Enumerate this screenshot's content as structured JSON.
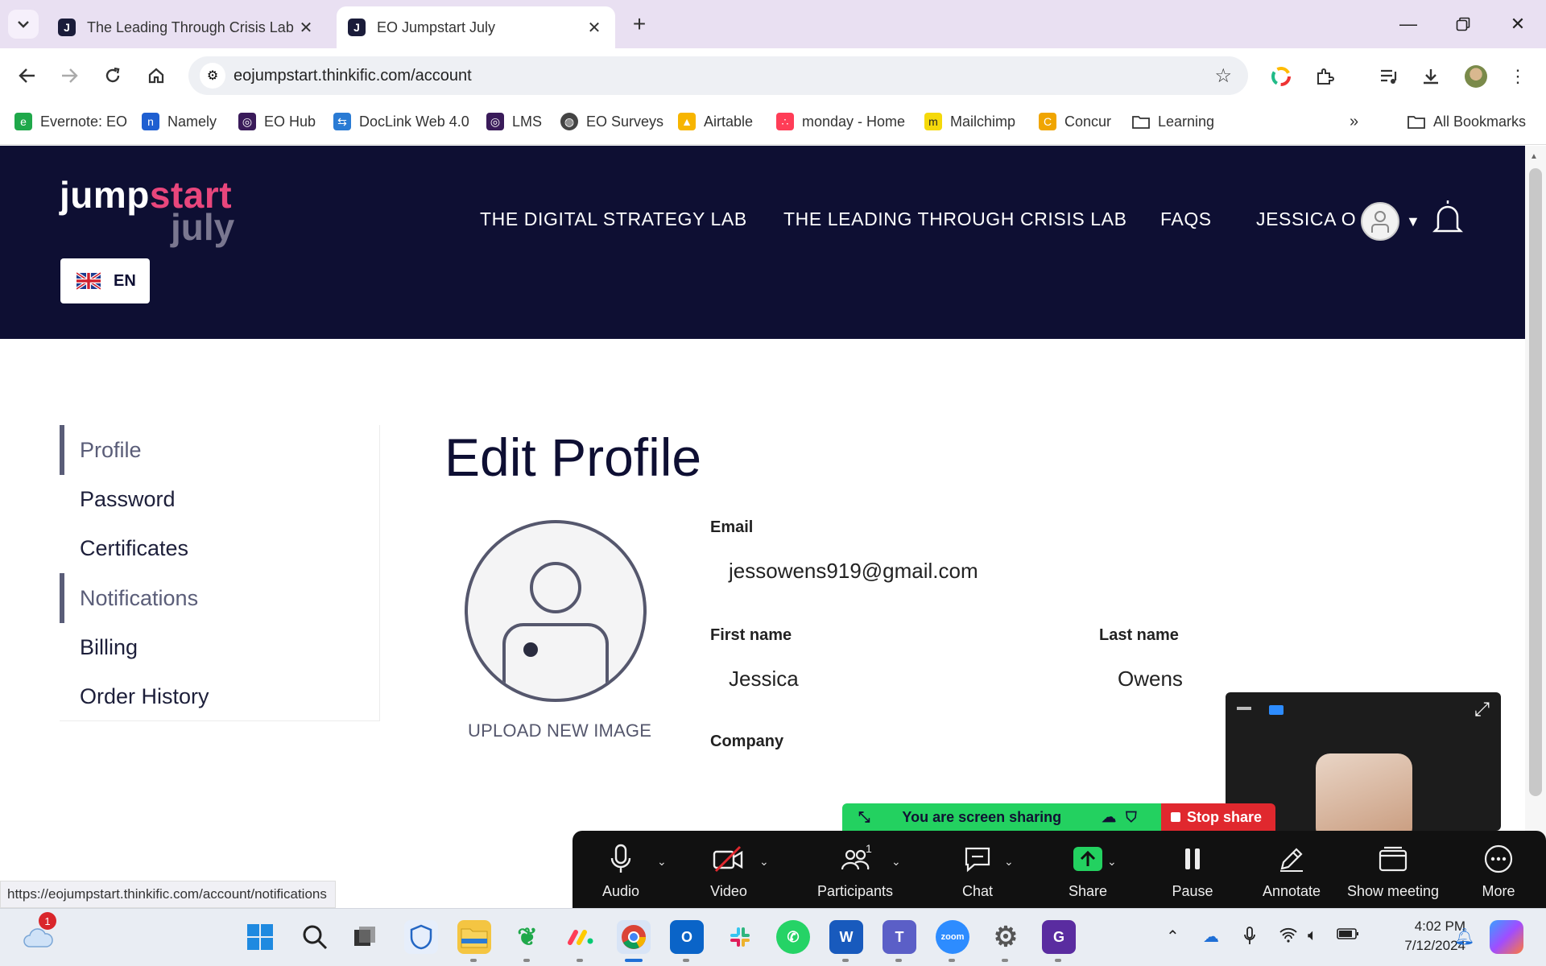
{
  "browser": {
    "tabs": [
      {
        "title": "The Leading Through Crisis Lab",
        "favicon": "J"
      },
      {
        "title": "EO Jumpstart July",
        "favicon": "J"
      }
    ],
    "url": "eojumpstart.thinkific.com/account",
    "bookmarks": [
      {
        "label": "Evernote: EO",
        "icon": "evernote-icon",
        "color": "#1fa84a"
      },
      {
        "label": "Namely",
        "icon": "namely-icon",
        "color": "#1f5fd1"
      },
      {
        "label": "EO Hub",
        "icon": "eo-hub-icon",
        "color": "#3a1b5a"
      },
      {
        "label": "DocLink Web 4.0",
        "icon": "doclink-icon",
        "color": "#2a7bd4"
      },
      {
        "label": "LMS",
        "icon": "lms-icon",
        "color": "#3a1b5a"
      },
      {
        "label": "EO Surveys",
        "icon": "globe-icon",
        "color": "#444444"
      },
      {
        "label": "Airtable",
        "icon": "airtable-icon",
        "color": "#f7b500"
      },
      {
        "label": "monday - Home",
        "icon": "monday-icon",
        "color": "#ff3d57"
      },
      {
        "label": "Mailchimp",
        "icon": "mailchimp-icon",
        "color": "#f5d90a"
      },
      {
        "label": "Concur",
        "icon": "concur-icon",
        "color": "#f0a500"
      },
      {
        "label": "Learning",
        "icon": "folder-icon",
        "color": "#ffffff"
      }
    ],
    "all_bookmarks": "All Bookmarks",
    "status_url": "https://eojumpstart.thinkific.com/account/notifications"
  },
  "site": {
    "logo_part1": "jump",
    "logo_part2": "start",
    "logo_line2": "july",
    "language": "EN",
    "nav": [
      "THE DIGITAL STRATEGY LAB",
      "THE LEADING THROUGH CRISIS LAB",
      "FAQS"
    ],
    "user_name": "JESSICA O"
  },
  "sidebar": {
    "items": [
      {
        "label": "Profile"
      },
      {
        "label": "Password"
      },
      {
        "label": "Certificates"
      },
      {
        "label": "Notifications"
      },
      {
        "label": "Billing"
      },
      {
        "label": "Order History"
      }
    ]
  },
  "profile": {
    "title": "Edit Profile",
    "upload_label": "UPLOAD NEW IMAGE",
    "email_label": "Email",
    "email": "jessowens919@gmail.com",
    "first_name_label": "First name",
    "first_name": "Jessica",
    "last_name_label": "Last name",
    "last_name": "Owens",
    "company_label": "Company"
  },
  "zoom": {
    "sharing_text": "You are screen sharing",
    "stop_share": "Stop share",
    "participants_count": "1",
    "controls": [
      "Audio",
      "Video",
      "Participants",
      "Chat",
      "Share",
      "Pause",
      "Annotate",
      "Show meeting",
      "More"
    ]
  },
  "taskbar": {
    "notification_badge": "1",
    "time": "4:02 PM",
    "date": "7/12/2024"
  },
  "colors": {
    "header_bg": "#0e0f33",
    "logo_accent": "#e8467c",
    "share_green": "#23d160",
    "stop_red": "#e0282e"
  }
}
